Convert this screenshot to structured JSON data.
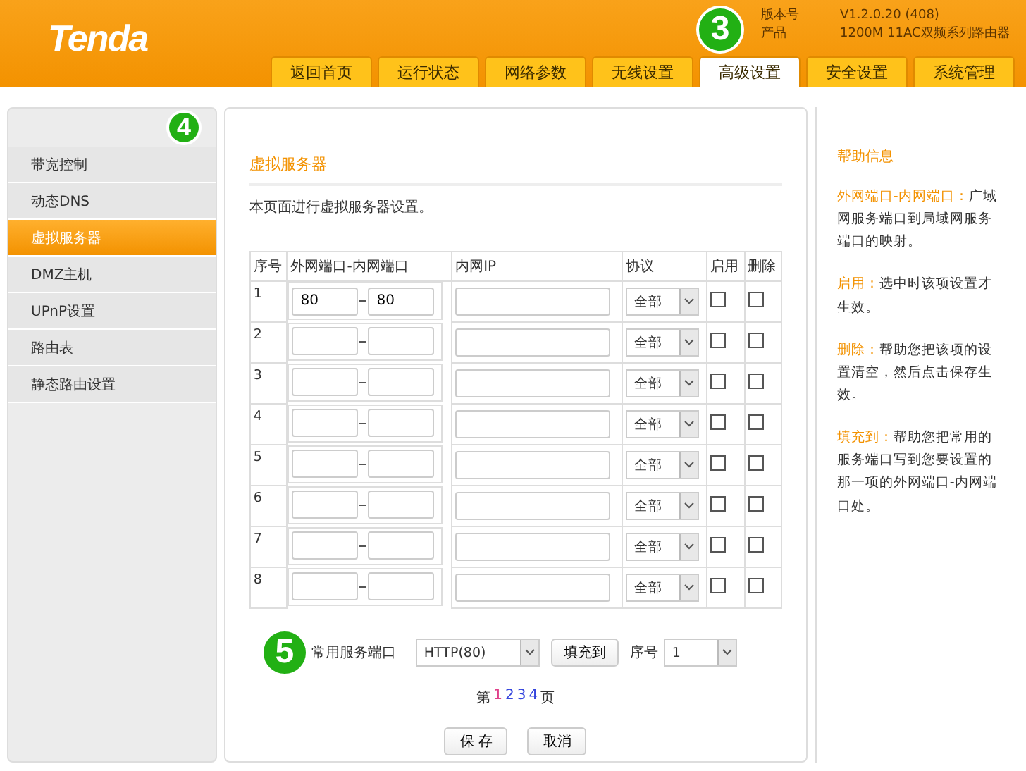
{
  "header": {
    "logo": "Tenda",
    "version_label": "版本号",
    "version": "V1.2.0.20 (408)",
    "product_label": "产品",
    "product": "1200M 11AC双频系列路由器",
    "tabs": [
      {
        "label": "返回首页",
        "selected": false
      },
      {
        "label": "运行状态",
        "selected": false
      },
      {
        "label": "网络参数",
        "selected": false
      },
      {
        "label": "无线设置",
        "selected": false
      },
      {
        "label": "高级设置",
        "selected": true
      },
      {
        "label": "安全设置",
        "selected": false
      },
      {
        "label": "系统管理",
        "selected": false
      }
    ]
  },
  "sidebar": {
    "items": [
      {
        "label": "带宽控制",
        "selected": false
      },
      {
        "label": "动态DNS",
        "selected": false
      },
      {
        "label": "虚拟服务器",
        "selected": true
      },
      {
        "label": "DMZ主机",
        "selected": false
      },
      {
        "label": "UPnP设置",
        "selected": false
      },
      {
        "label": "路由表",
        "selected": false
      },
      {
        "label": "静态路由设置",
        "selected": false
      }
    ]
  },
  "main": {
    "title": "虚拟服务器",
    "description": "本页面进行虚拟服务器设置。",
    "table": {
      "columns": [
        "序号",
        "外网端口-内网端口",
        "内网IP",
        "协议",
        "启用",
        "删除"
      ],
      "rows": [
        {
          "index": "1",
          "ext_port": "80",
          "int_port": "80",
          "protocol": "全部",
          "enabled": false,
          "delete": false
        },
        {
          "index": "2",
          "protocol": "全部",
          "enabled": false,
          "delete": false
        },
        {
          "index": "3",
          "protocol": "全部",
          "enabled": false,
          "delete": false
        },
        {
          "index": "4",
          "protocol": "全部",
          "enabled": false,
          "delete": false
        },
        {
          "index": "5",
          "protocol": "全部",
          "enabled": false,
          "delete": false
        },
        {
          "index": "6",
          "protocol": "全部",
          "enabled": false,
          "delete": false
        },
        {
          "index": "7",
          "protocol": "全部",
          "enabled": false,
          "delete": false
        },
        {
          "index": "8",
          "protocol": "全部",
          "enabled": false,
          "delete": false
        }
      ]
    },
    "common_port_label": "常用服务端口",
    "common_port_value": "HTTP(80)",
    "fill_button": "填充到",
    "index_label": "序号",
    "index_value": "1",
    "pager": {
      "prefix": "第",
      "suffix": "页",
      "pages": [
        {
          "label": "1",
          "selected": true
        },
        {
          "label": "2",
          "selected": false
        },
        {
          "label": "3",
          "selected": false
        },
        {
          "label": "4",
          "selected": false
        }
      ]
    },
    "buttons": [
      "保 存",
      "取消"
    ]
  },
  "help": {
    "title": "帮助信息",
    "items": [
      {
        "term": "外网端口-内网端口：",
        "text": "广域网服务端口到局域网服务端口的映射。"
      },
      {
        "term": "启用：",
        "text": "选中时该项设置才生效。"
      },
      {
        "term": "删除：",
        "text": "帮助您把该项的设置清空，然后点击保存生效。"
      },
      {
        "term": "填充到：",
        "text": "帮助您把常用的服务端口写到您要设置的那一项的外网端口-内网端口处。"
      }
    ]
  },
  "badges": [
    "3",
    "4",
    "5"
  ]
}
